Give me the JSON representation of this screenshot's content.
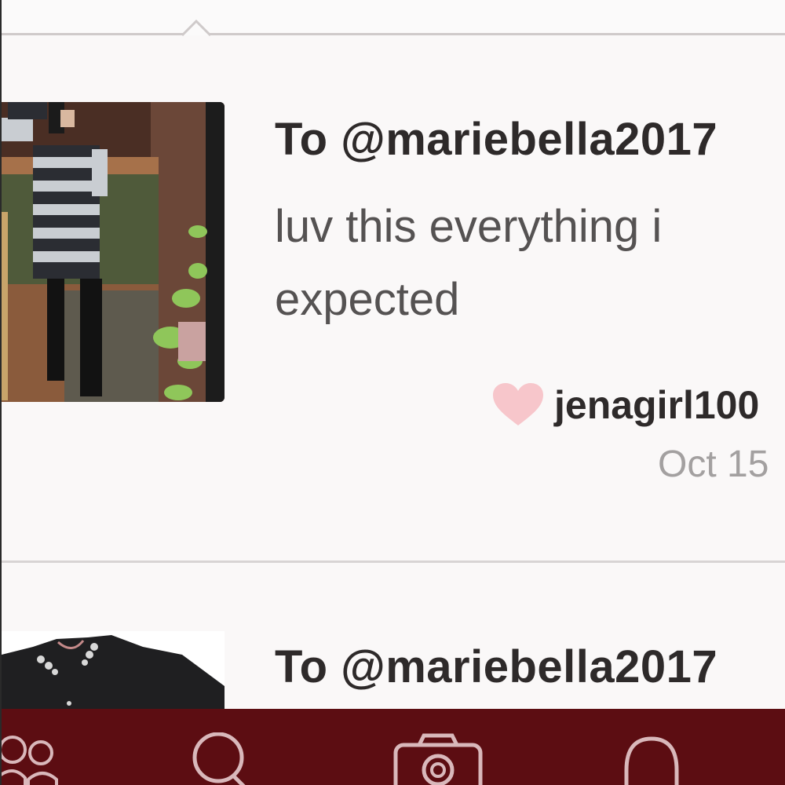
{
  "reviews": [
    {
      "to_line": "To @mariebella2017",
      "comment": "luv this everything i expected",
      "author": "jenagirl100",
      "date": "Oct 15",
      "image": "mirror-selfie-striped-dress"
    },
    {
      "to_line": "To @mariebella2017",
      "image": "black-embellished-top"
    }
  ],
  "icons": {
    "heart": "heart-icon",
    "nav": [
      "people-icon",
      "search-icon",
      "camera-icon",
      "bell-icon"
    ]
  },
  "colors": {
    "nav_background": "#5c0d12",
    "heart": "#f7c6cb",
    "date": "#a3a0a0"
  }
}
